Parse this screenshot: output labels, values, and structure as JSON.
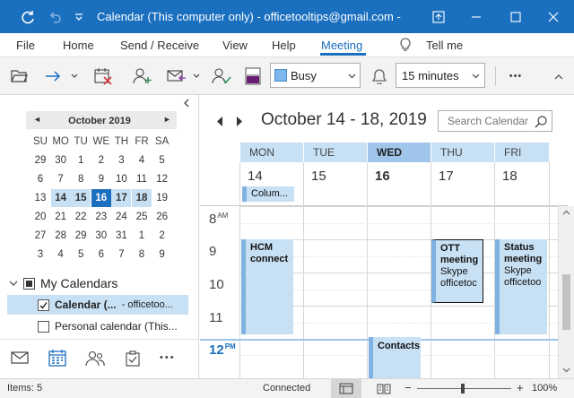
{
  "titlebar": {
    "title": "Calendar (This computer only) - officetooltips@gmail.com  -",
    "accent": "#1a6fbf"
  },
  "menu": {
    "items": [
      "File",
      "Home",
      "Send / Receive",
      "View",
      "Help",
      "Meeting"
    ],
    "tell_me": "Tell me",
    "active": "Meeting"
  },
  "toolbar": {
    "show_as": "Busy",
    "reminder": "15 minutes",
    "more": "•••"
  },
  "mini_calendar": {
    "month": "October 2019",
    "prev": "◄",
    "next": "►",
    "weekdays": [
      "SU",
      "MO",
      "TU",
      "WE",
      "TH",
      "FR",
      "SA"
    ],
    "weeks": [
      [
        "29",
        "30",
        "1",
        "2",
        "3",
        "4",
        "5"
      ],
      [
        "6",
        "7",
        "8",
        "9",
        "10",
        "11",
        "12"
      ],
      [
        "13",
        "14",
        "15",
        "16",
        "17",
        "18",
        "19"
      ],
      [
        "20",
        "21",
        "22",
        "23",
        "24",
        "25",
        "26"
      ],
      [
        "27",
        "28",
        "29",
        "30",
        "31",
        "1",
        "2"
      ],
      [
        "3",
        "4",
        "5",
        "6",
        "7",
        "8",
        "9"
      ]
    ],
    "today": "16"
  },
  "calendars": {
    "group": "My Calendars",
    "items": [
      {
        "name": "Calendar (...",
        "account": "- officetoo...",
        "checked": true
      },
      {
        "name": "Personal calendar (This...",
        "account": "",
        "checked": false
      }
    ]
  },
  "calendar_view": {
    "range_title": "October 14 - 18, 2019",
    "search_placeholder": "Search Calendar",
    "days": [
      {
        "dow": "MON",
        "num": "14"
      },
      {
        "dow": "TUE",
        "num": "15"
      },
      {
        "dow": "WED",
        "num": "16"
      },
      {
        "dow": "THU",
        "num": "17"
      },
      {
        "dow": "FRI",
        "num": "18"
      }
    ],
    "allday_event": "Colum...",
    "hours": [
      {
        "h": "8",
        "ampm": "AM"
      },
      {
        "h": "9",
        "ampm": ""
      },
      {
        "h": "10",
        "ampm": ""
      },
      {
        "h": "11",
        "ampm": ""
      },
      {
        "h": "12",
        "ampm": "PM"
      }
    ],
    "events": {
      "hcm": {
        "title": "HCM connect"
      },
      "ott": {
        "title": "OTT meeting",
        "line1": "Skype",
        "line2": "officetoc"
      },
      "status": {
        "title": "Status meeting",
        "line1": "Skype",
        "line2": "officetoo"
      },
      "contacts": {
        "title": "Contacts"
      }
    }
  },
  "statusbar": {
    "items": "Items: 5",
    "connection": "Connected",
    "zoom_minus": "−",
    "zoom_plus": "+",
    "zoom": "100%"
  }
}
